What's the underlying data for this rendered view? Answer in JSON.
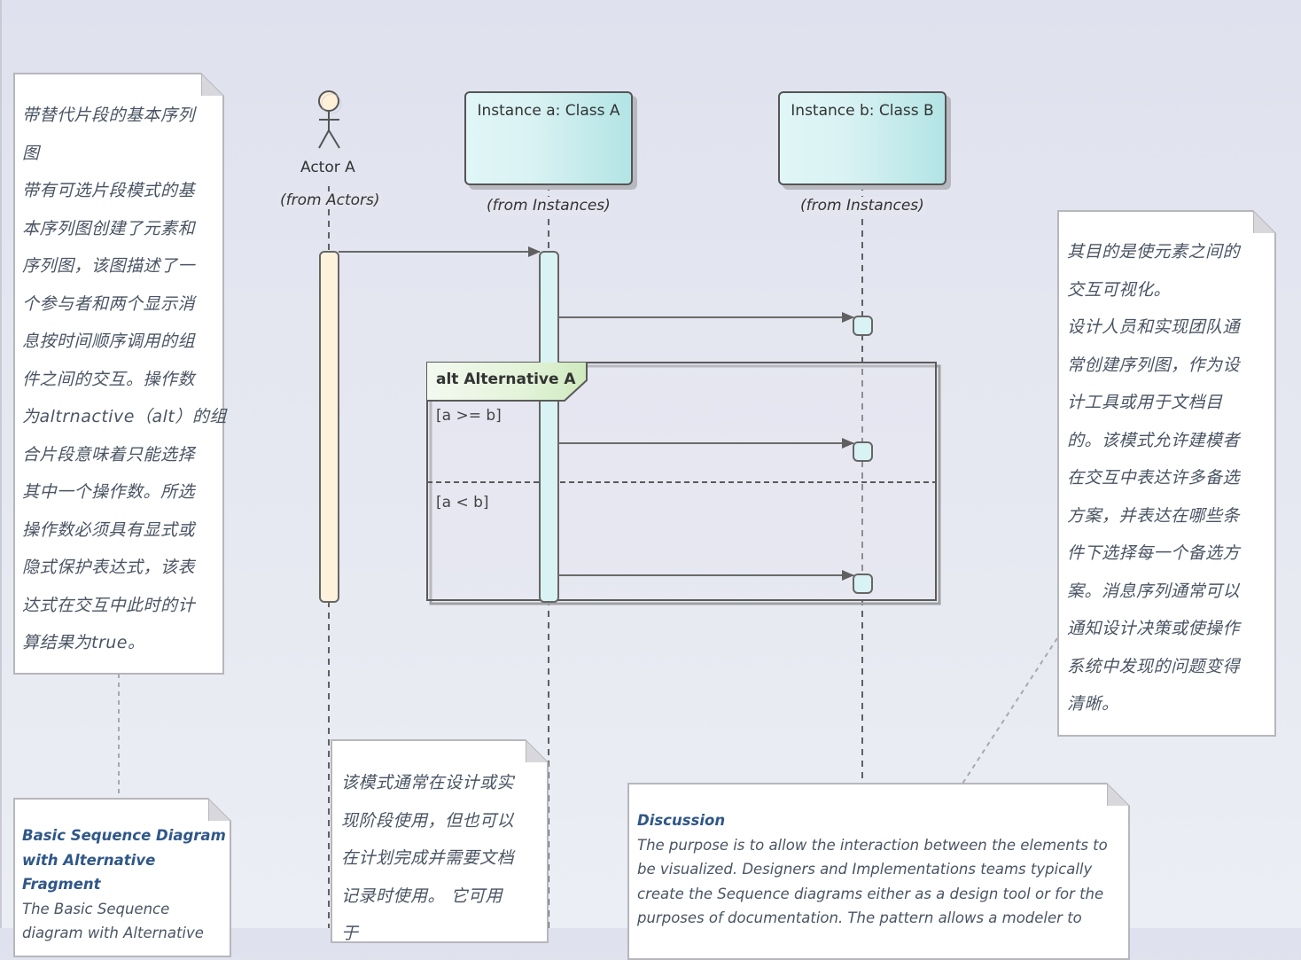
{
  "diagram": {
    "type": "UML sequence diagram",
    "actor": {
      "name": "Actor A",
      "from": "(from Actors)"
    },
    "lifelines": [
      {
        "name": "Instance a: Class A",
        "from": "(from Instances)"
      },
      {
        "name": "Instance b: Class B",
        "from": "(from Instances)"
      }
    ],
    "messages": [
      {
        "from": "Actor A",
        "to": "Instance a: Class A"
      },
      {
        "from": "Instance a: Class A",
        "to": "Instance b: Class B"
      },
      {
        "from": "Instance a: Class A",
        "to": "Instance b: Class B",
        "operand": "[a >= b]"
      },
      {
        "from": "Instance a: Class A",
        "to": "Instance b: Class B",
        "operand": "[a < b]"
      }
    ],
    "fragment": {
      "label": "alt Alternative A",
      "operands": [
        "[a >= b]",
        "[a < b]"
      ]
    }
  },
  "notes": {
    "left_cn": {
      "lines": [
        "带替代片段的基本序列",
        "图",
        "带有可选片段模式的基",
        "本序列图创建了元素和",
        "序列图，该图描述了一",
        "个参与者和两个显示消",
        "息按时间顺序调用的组",
        "件之间的交互。操作数",
        "为altrnactive（alt）的组",
        "合片段意味着只能选择",
        "其中一个操作数。所选",
        "操作数必须具有显式或",
        "隐式保护表达式，该表",
        "达式在交互中此时的计",
        "算结果为true。"
      ]
    },
    "right_cn": {
      "lines": [
        "其目的是使元素之间的",
        "交互可视化。",
        "设计人员和实现团队通",
        "常创建序列图，作为设",
        "计工具或用于文档目",
        "的。该模式允许建模者",
        "在交互中表达许多备选",
        "方案，并表达在哪些条",
        "件下选择每一个备选方",
        "案。消息序列通常可以",
        "通知设计决策或使操作",
        "系统中发现的问题变得",
        "清晰。"
      ]
    },
    "bottom_mid_cn": {
      "lines": [
        "该模式通常在设计或实",
        "现阶段使用，但也可以",
        "在计划完成并需要文档",
        "记录时使用。 它可用",
        "于"
      ]
    },
    "bottom_left_en": {
      "title_lines": [
        "Basic Sequence Diagram",
        "with Alternative",
        "Fragment"
      ],
      "body_lines": [
        "The Basic Sequence",
        "diagram with Alternative"
      ]
    },
    "discussion_en": {
      "title": "Discussion",
      "body_lines": [
        "The purpose is to allow the interaction between the elements to",
        "be visualized. Designers and Implementations teams typically",
        "create the Sequence diagrams either as a design tool or for the",
        "purposes of documentation. The pattern allows a modeler to"
      ]
    }
  },
  "colors": {
    "background": "#e2e4ef",
    "actor_activation": "#fff2dd",
    "instance_fill": "#d9f2f3",
    "fragment_tag": "#e3f3d9",
    "note_title": "#2f5789",
    "line": "#5a5a5a"
  }
}
